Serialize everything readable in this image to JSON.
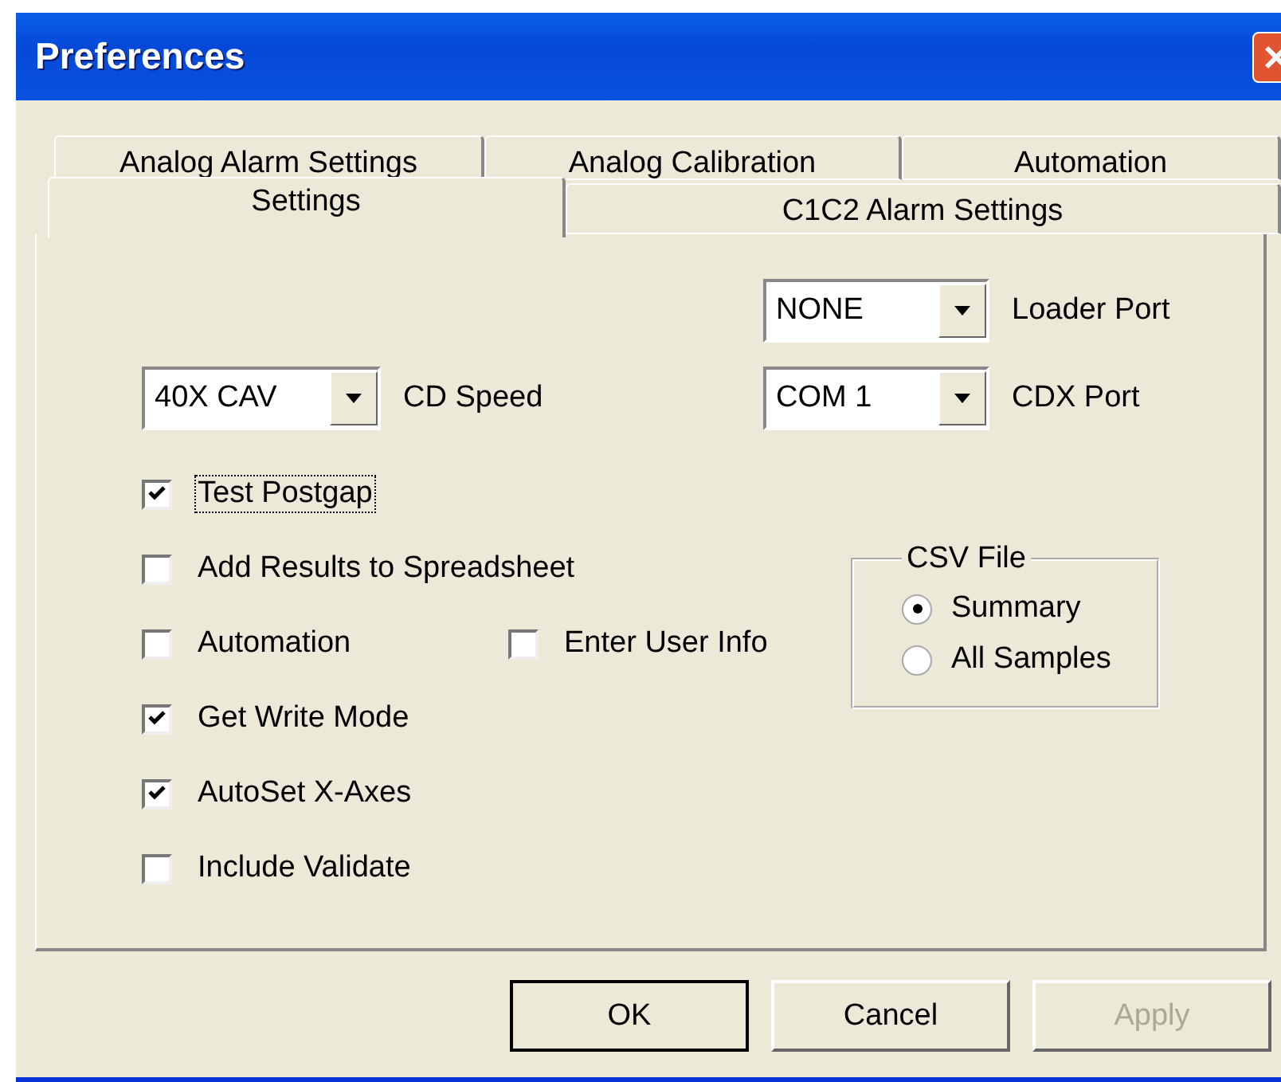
{
  "window": {
    "title": "Preferences"
  },
  "tab_rows": [
    {
      "tabs": [
        {
          "label": "Analog Alarm Settings",
          "selected": false
        },
        {
          "label": "Analog Calibration",
          "selected": false
        },
        {
          "label": "Automation",
          "selected": false
        }
      ]
    },
    {
      "tabs": [
        {
          "label": "Settings",
          "selected": true
        },
        {
          "label": "C1C2 Alarm Settings",
          "selected": false
        }
      ]
    }
  ],
  "loader_port": {
    "value": "NONE",
    "label": "Loader Port"
  },
  "cd_speed": {
    "value": "40X CAV",
    "label": "CD Speed"
  },
  "cdx_port": {
    "value": "COM 1",
    "label": "CDX Port"
  },
  "checkbox_rows": [
    {
      "items": [
        {
          "label": "Test Postgap",
          "checked": true,
          "focused": true
        }
      ]
    },
    {
      "items": [
        {
          "label": "Add Results to Spreadsheet",
          "checked": false,
          "focused": false
        }
      ]
    },
    {
      "items": [
        {
          "label": "Automation",
          "checked": false,
          "focused": false
        },
        {
          "label": "Enter User Info",
          "checked": false,
          "focused": false
        }
      ]
    },
    {
      "items": [
        {
          "label": "Get Write Mode",
          "checked": true,
          "focused": false
        }
      ]
    },
    {
      "items": [
        {
          "label": "AutoSet X-Axes",
          "checked": true,
          "focused": false
        }
      ]
    },
    {
      "items": [
        {
          "label": "Include Validate",
          "checked": false,
          "focused": false
        }
      ]
    }
  ],
  "csv_file": {
    "title": "CSV File",
    "options": [
      {
        "label": "Summary",
        "selected": true
      },
      {
        "label": "All Samples",
        "selected": false
      }
    ]
  },
  "buttons": [
    {
      "label": "OK",
      "default": true,
      "disabled": false
    },
    {
      "label": "Cancel",
      "default": false,
      "disabled": false
    },
    {
      "label": "Apply",
      "default": false,
      "disabled": true
    }
  ]
}
